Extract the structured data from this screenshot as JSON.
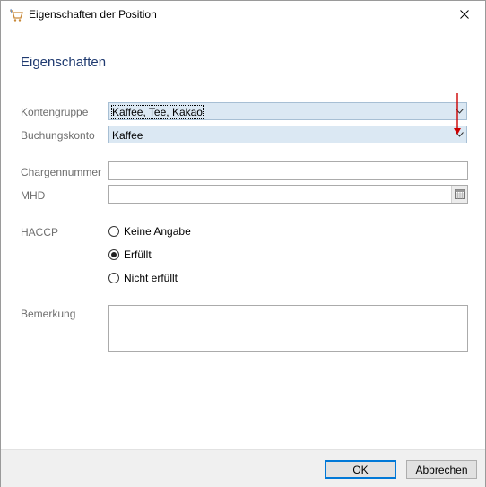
{
  "window": {
    "title": "Eigenschaften der Position"
  },
  "section": {
    "heading": "Eigenschaften"
  },
  "fields": {
    "kontengruppe": {
      "label": "Kontengruppe",
      "value": "Kaffee, Tee, Kakao"
    },
    "buchungskonto": {
      "label": "Buchungskonto",
      "value": "Kaffee"
    },
    "chargennummer": {
      "label": "Chargennummer",
      "value": ""
    },
    "mhd": {
      "label": "MHD",
      "value": ""
    },
    "haccp": {
      "label": "HACCP",
      "options": [
        "Keine Angabe",
        "Erfüllt",
        "Nicht erfüllt"
      ],
      "selected": "Erfüllt"
    },
    "bemerkung": {
      "label": "Bemerkung",
      "value": ""
    }
  },
  "buttons": {
    "ok": "OK",
    "cancel": "Abbrechen"
  },
  "colors": {
    "heading": "#1f3a70",
    "combo_bg": "#dbe8f3",
    "annotation_arrow": "#cc0000",
    "default_button_border": "#0078d7"
  }
}
